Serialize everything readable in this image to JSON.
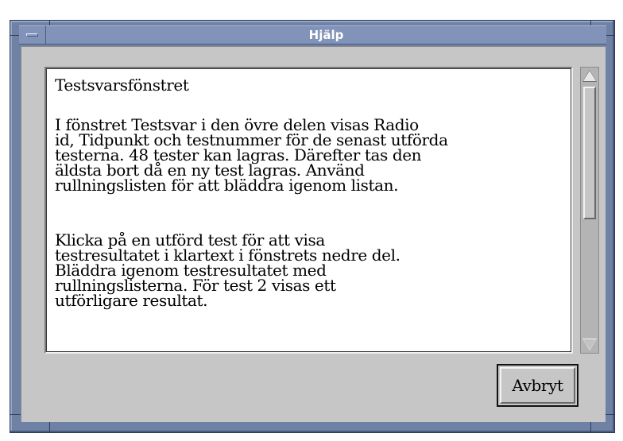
{
  "window": {
    "title": "Hjälp",
    "menu_icon": "window-menu-icon"
  },
  "help": {
    "heading": "Testsvarsfönstret",
    "paragraphs": [
      "I fönstret Testsvar i den övre delen visas Radio\nid, Tidpunkt och testnummer för de senast utförda\ntesterna. 48 tester kan lagras. Därefter tas den\näldsta bort då en ny test lagras. Använd\nrullningslisten för att bläddra igenom listan.",
      "Klicka på en utförd test för att visa\ntestresultatet i klartext i fönstrets nedre del.\nBläddra igenom testresultatet med\nrullningslisterna. För test 2 visas ett\nutförligare resultat."
    ]
  },
  "buttons": {
    "cancel_label": "Avbryt"
  },
  "scrollbar": {
    "up_icon": "scroll-up-arrow-icon",
    "down_icon": "scroll-down-arrow-icon",
    "thumb_fraction": 0.5
  },
  "colors": {
    "frame": "#6f82a6",
    "titlebar": "#8193b8",
    "client": "#c6c6c6"
  }
}
